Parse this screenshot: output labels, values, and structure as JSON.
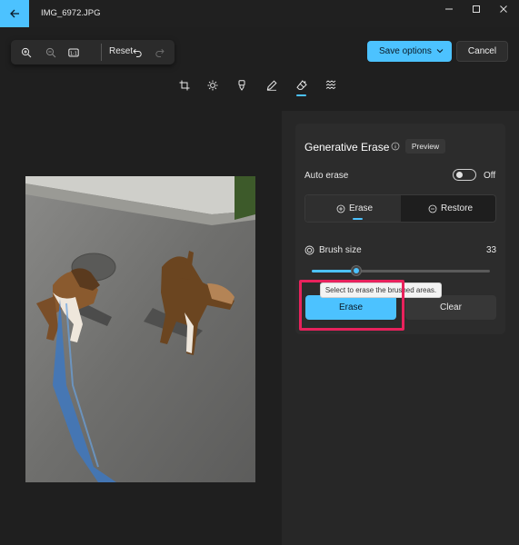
{
  "titlebar": {
    "filename": "IMG_6972.JPG",
    "back_icon": "back-arrow-icon",
    "controls": [
      "minimize-icon",
      "maximize-icon",
      "close-icon"
    ]
  },
  "zoom_toolbar": {
    "icons": [
      "zoom-in-icon",
      "zoom-out-icon",
      "actual-size-icon",
      "undo-icon",
      "redo-icon"
    ],
    "reset_label": "Reset"
  },
  "actions": {
    "save_label": "Save options",
    "cancel_label": "Cancel"
  },
  "tools": [
    "crop-icon",
    "adjust-brightness-icon",
    "filter-icon",
    "markup-pen-icon",
    "erase-icon",
    "background-icon"
  ],
  "panel": {
    "title": "Generative Erase",
    "preview_label": "Preview",
    "auto_erase_label": "Auto erase",
    "auto_erase_state": "Off",
    "mode_erase_label": "Erase",
    "mode_restore_label": "Restore",
    "brush_size_label": "Brush size",
    "brush_size_value": "33",
    "brush_size_fraction": 0.25,
    "erase_button_label": "Erase",
    "clear_button_label": "Clear",
    "tooltip": "Select to erase the brushed areas."
  },
  "colors": {
    "accent": "#4cc2ff",
    "highlight": "#e8225c",
    "background": "#1f1f1f"
  }
}
